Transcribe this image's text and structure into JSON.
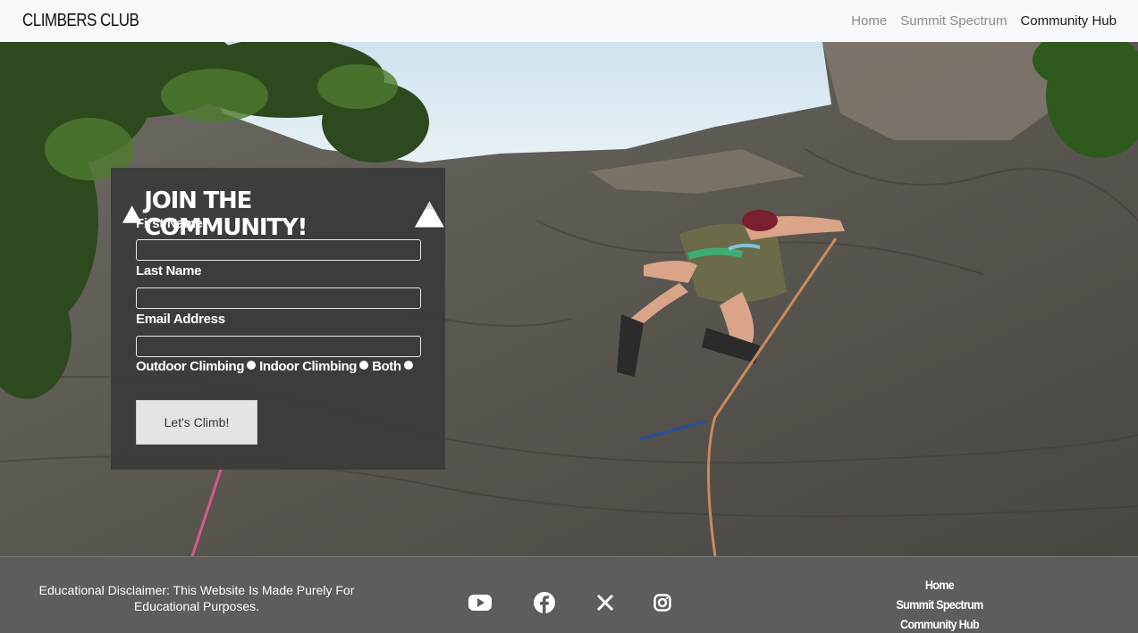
{
  "navbar": {
    "brand": "CLIMBERS CLUB",
    "links": [
      {
        "label": "Home",
        "active": false
      },
      {
        "label": "Summit Spectrum",
        "active": false
      },
      {
        "label": "Community Hub",
        "active": true
      }
    ]
  },
  "hero": {
    "image_description_icon": "rock-climber-photo"
  },
  "form": {
    "title": "JOIN THE COMMUNITY!",
    "first_name_label": "First Name",
    "first_name_value": "",
    "last_name_label": "Last Name",
    "last_name_value": "",
    "email_label": "Email Address",
    "email_value": "",
    "options": [
      "Outdoor Climbing",
      "Indoor Climbing",
      "Both"
    ],
    "submit_label": "Let's Climb!"
  },
  "footer": {
    "disclaimer": "Educational Disclaimer: This Website Is Made Purely For Educational Purposes.",
    "social_icons": [
      "youtube-icon",
      "facebook-icon",
      "x-icon",
      "instagram-icon"
    ],
    "links": [
      "Home",
      "Summit Spectrum",
      "Community Hub"
    ]
  },
  "colors": {
    "navbar_bg": "#f8f9fa",
    "card_bg": "#3a3a3a",
    "footer_bg": "#5e5d5c",
    "button_bg": "#e4e4e4"
  }
}
